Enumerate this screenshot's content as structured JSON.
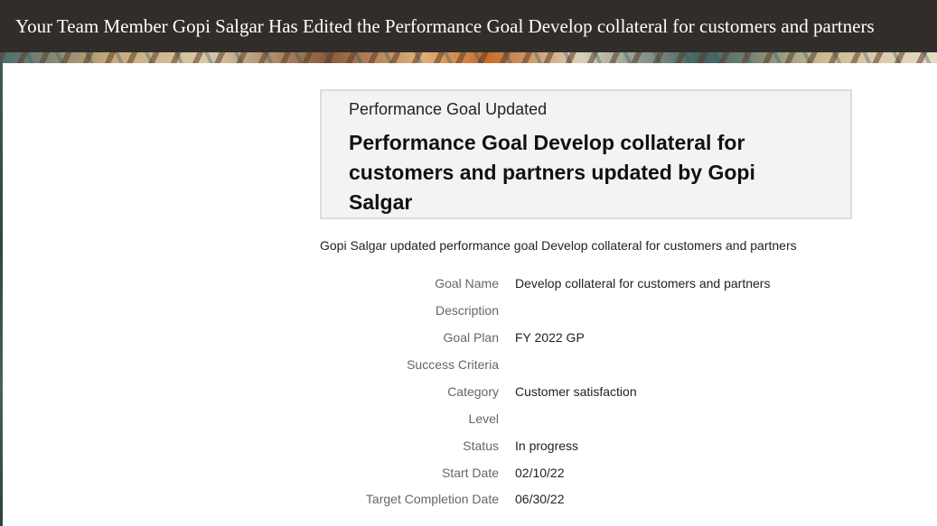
{
  "header": {
    "title": "Your Team Member Gopi Salgar Has Edited the Performance Goal Develop collateral for customers and partners"
  },
  "card": {
    "kicker": "Performance Goal Updated",
    "title": "Performance Goal Develop collateral for customers and partners updated by Gopi Salgar"
  },
  "summary": "Gopi Salgar updated performance goal Develop collateral for customers and partners",
  "details": [
    {
      "label": "Goal Name",
      "value": "Develop collateral for customers and partners"
    },
    {
      "label": "Description",
      "value": ""
    },
    {
      "label": "Goal Plan",
      "value": "FY 2022 GP"
    },
    {
      "label": "Success Criteria",
      "value": ""
    },
    {
      "label": "Category",
      "value": "Customer satisfaction"
    },
    {
      "label": "Level",
      "value": ""
    },
    {
      "label": "Status",
      "value": "In progress"
    },
    {
      "label": "Start Date",
      "value": "02/10/22"
    },
    {
      "label": "Target Completion Date",
      "value": "06/30/22"
    }
  ]
}
